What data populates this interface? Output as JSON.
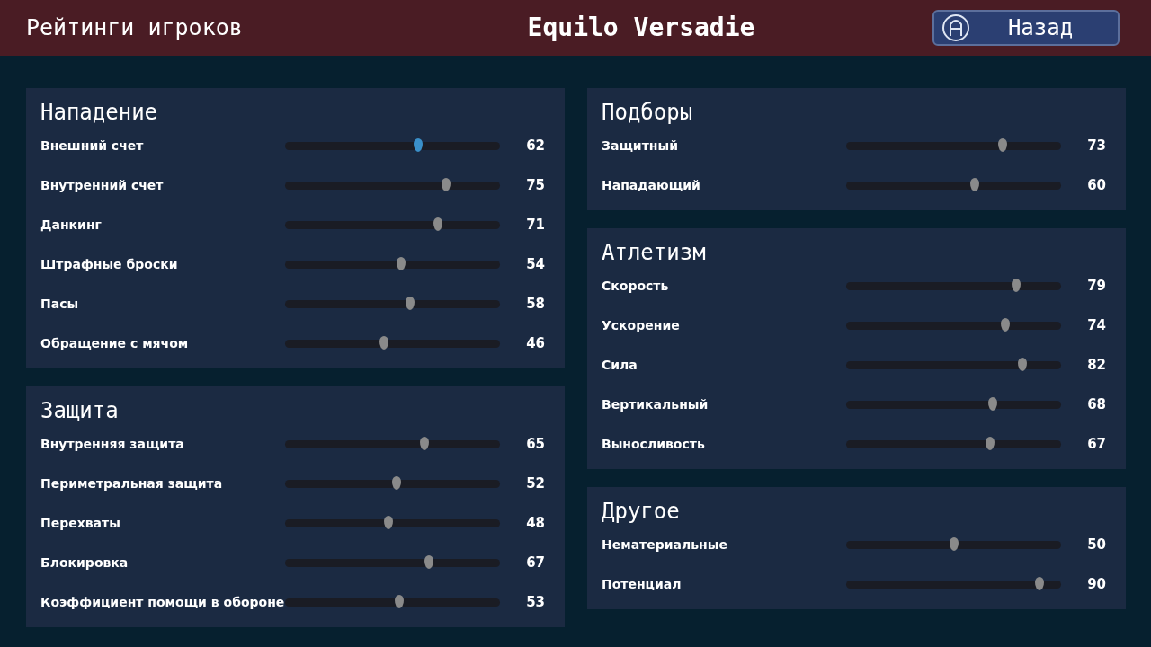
{
  "header": {
    "title": "Рейтинги игроков",
    "player_name": "Equilo Versadie",
    "back_button": {
      "label": "Назад"
    }
  },
  "columns": [
    [
      {
        "title": "Нападение",
        "ratings": [
          {
            "label": "Внешний счет",
            "level": 0.62,
            "value": "62",
            "selected": true
          },
          {
            "label": "Внутренний счет",
            "level": 0.75,
            "value": "75",
            "selected": false
          },
          {
            "label": "Данкинг",
            "level": 0.71,
            "value": "71",
            "selected": false
          },
          {
            "label": "Штрафные броски",
            "level": 0.54,
            "value": "54",
            "selected": false
          },
          {
            "label": "Пасы",
            "level": 0.58,
            "value": "58",
            "selected": false
          },
          {
            "label": "Обращение с мячом",
            "level": 0.46,
            "value": "46",
            "selected": false
          }
        ]
      },
      {
        "title": "Защита",
        "ratings": [
          {
            "label": "Внутренняя защита",
            "level": 0.65,
            "value": "65",
            "selected": false
          },
          {
            "label": "Периметральная защита",
            "level": 0.52,
            "value": "52",
            "selected": false
          },
          {
            "label": "Перехваты",
            "level": 0.48,
            "value": "48",
            "selected": false
          },
          {
            "label": "Блокировка",
            "level": 0.67,
            "value": "67",
            "selected": false
          },
          {
            "label": "Коэффициент помощи в обороне",
            "level": 0.53,
            "value": "53",
            "selected": false
          }
        ]
      }
    ],
    [
      {
        "title": "Подборы",
        "ratings": [
          {
            "label": "Защитный",
            "level": 0.73,
            "value": "73",
            "selected": false
          },
          {
            "label": "Нападающий",
            "level": 0.6,
            "value": "60",
            "selected": false
          }
        ]
      },
      {
        "title": "Атлетизм",
        "ratings": [
          {
            "label": "Скорость",
            "level": 0.79,
            "value": "79",
            "selected": false
          },
          {
            "label": "Ускорение",
            "level": 0.74,
            "value": "74",
            "selected": false
          },
          {
            "label": "Сила",
            "level": 0.82,
            "value": "82",
            "selected": false
          },
          {
            "label": "Вертикальный",
            "level": 0.68,
            "value": "68",
            "selected": false
          },
          {
            "label": "Выносливость",
            "level": 0.67,
            "value": "67",
            "selected": false
          }
        ]
      },
      {
        "title": "Другое",
        "ratings": [
          {
            "label": "Нематериальные",
            "level": 0.5,
            "value": "50",
            "selected": false
          },
          {
            "label": "Потенциал",
            "level": 0.9,
            "value": "90",
            "selected": false
          }
        ]
      }
    ]
  ]
}
